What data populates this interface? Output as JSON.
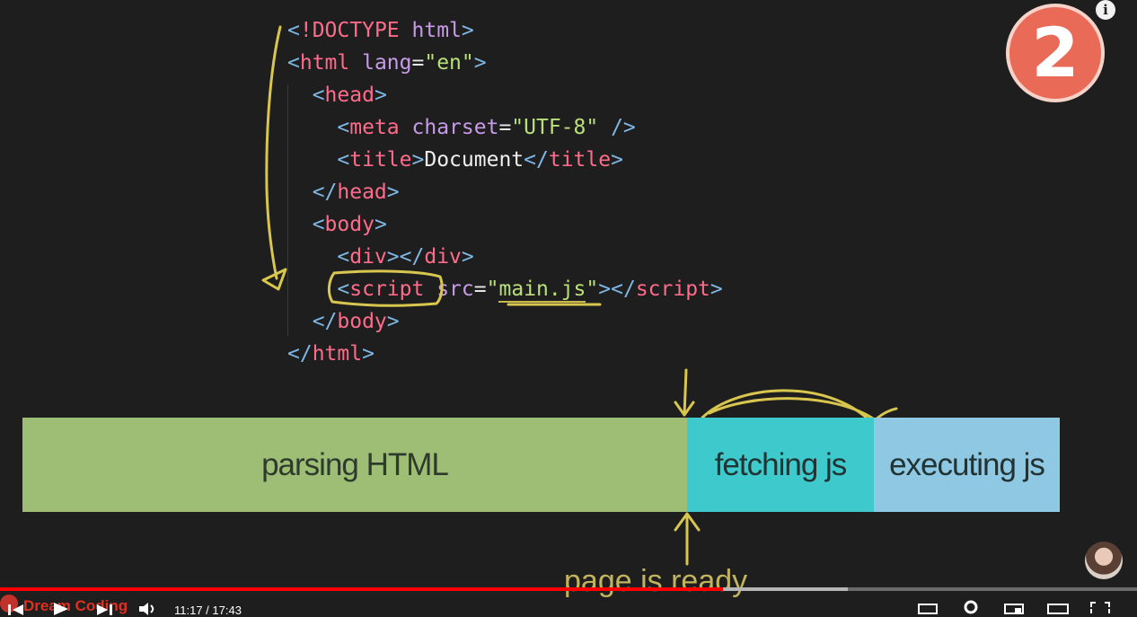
{
  "code_lines": [
    [
      {
        "t": "<",
        "c": "br"
      },
      {
        "t": "!DOCTYPE",
        "c": "tag"
      },
      {
        "t": " ",
        "c": "eq"
      },
      {
        "t": "html",
        "c": "attr"
      },
      {
        "t": ">",
        "c": "br"
      }
    ],
    [
      {
        "t": "<",
        "c": "br"
      },
      {
        "t": "html",
        "c": "tag"
      },
      {
        "t": " ",
        "c": "eq"
      },
      {
        "t": "lang",
        "c": "attr"
      },
      {
        "t": "=",
        "c": "eq"
      },
      {
        "t": "\"en\"",
        "c": "str"
      },
      {
        "t": ">",
        "c": "br"
      }
    ],
    [
      {
        "t": "  <",
        "c": "br"
      },
      {
        "t": "head",
        "c": "tag"
      },
      {
        "t": ">",
        "c": "br"
      }
    ],
    [
      {
        "t": "    <",
        "c": "br"
      },
      {
        "t": "meta",
        "c": "tag"
      },
      {
        "t": " ",
        "c": "eq"
      },
      {
        "t": "charset",
        "c": "attr"
      },
      {
        "t": "=",
        "c": "eq"
      },
      {
        "t": "\"UTF-8\"",
        "c": "str"
      },
      {
        "t": " />",
        "c": "br"
      }
    ],
    [
      {
        "t": "    <",
        "c": "br"
      },
      {
        "t": "title",
        "c": "tag"
      },
      {
        "t": ">",
        "c": "br"
      },
      {
        "t": "Document",
        "c": "txt"
      },
      {
        "t": "</",
        "c": "br"
      },
      {
        "t": "title",
        "c": "tag"
      },
      {
        "t": ">",
        "c": "br"
      }
    ],
    [
      {
        "t": "  </",
        "c": "br"
      },
      {
        "t": "head",
        "c": "tag"
      },
      {
        "t": ">",
        "c": "br"
      }
    ],
    [
      {
        "t": "  <",
        "c": "br"
      },
      {
        "t": "body",
        "c": "tag"
      },
      {
        "t": ">",
        "c": "br"
      }
    ],
    [
      {
        "t": "    <",
        "c": "br"
      },
      {
        "t": "div",
        "c": "tag"
      },
      {
        "t": "></",
        "c": "br"
      },
      {
        "t": "div",
        "c": "tag"
      },
      {
        "t": ">",
        "c": "br"
      }
    ],
    [
      {
        "t": "    <",
        "c": "br"
      },
      {
        "t": "script",
        "c": "tag"
      },
      {
        "t": " ",
        "c": "eq"
      },
      {
        "t": "src",
        "c": "attr"
      },
      {
        "t": "=",
        "c": "eq"
      },
      {
        "t": "\"",
        "c": "str"
      },
      {
        "t": "main.js",
        "c": "str",
        "u": true
      },
      {
        "t": "\"",
        "c": "str"
      },
      {
        "t": "></",
        "c": "br"
      },
      {
        "t": "script",
        "c": "tag"
      },
      {
        "t": ">",
        "c": "br"
      }
    ],
    [
      {
        "t": "  </",
        "c": "br"
      },
      {
        "t": "body",
        "c": "tag"
      },
      {
        "t": ">",
        "c": "br"
      }
    ],
    [
      {
        "t": "</",
        "c": "br"
      },
      {
        "t": "html",
        "c": "tag"
      },
      {
        "t": ">",
        "c": "br"
      }
    ]
  ],
  "timeline": {
    "parsing": "parsing HTML",
    "fetching": "fetching js",
    "executing": "executing js",
    "annotation": "page is ready"
  },
  "badge": {
    "number": "2"
  },
  "player": {
    "channel": "Dream Coding",
    "time": "11:17 / 17:43",
    "played_fraction": 0.636,
    "buffered_fraction": 0.746
  },
  "colors": {
    "parsing": "#9dbe74",
    "fetching": "#3ec9cc",
    "executing": "#8ec8e2",
    "annotation": "#c2b35d",
    "progress": "#ff0000"
  }
}
